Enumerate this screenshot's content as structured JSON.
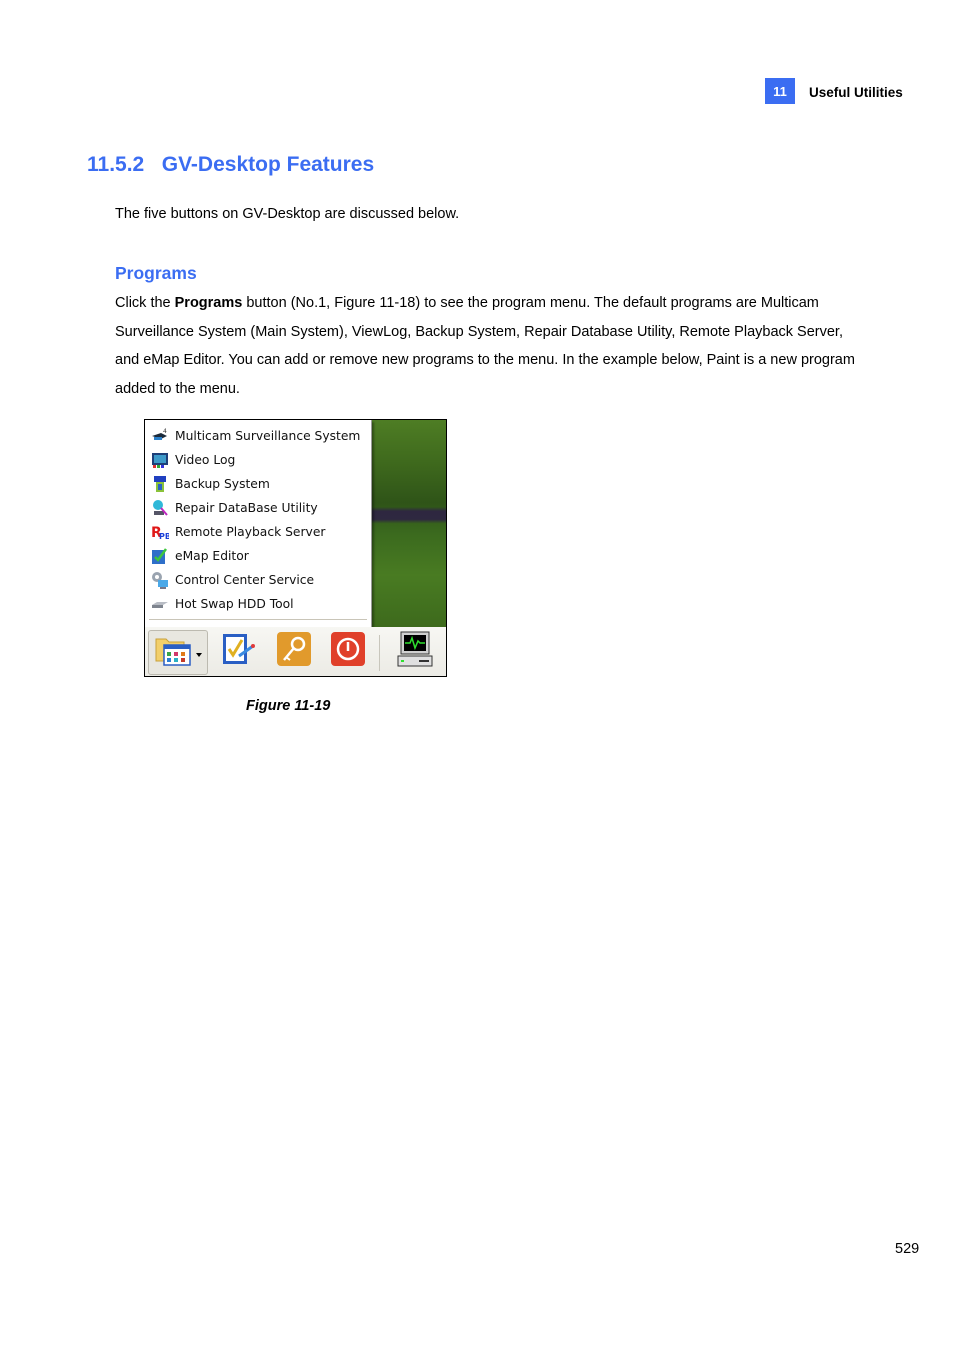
{
  "header": {
    "chapter_number": "11",
    "chapter_title": "Useful Utilities"
  },
  "section": {
    "number": "11.5.2",
    "title": "GV-Desktop Features",
    "intro": "The five buttons on GV-Desktop are discussed below."
  },
  "programs": {
    "heading": "Programs",
    "para_prefix": "Click the ",
    "para_bold": "Programs",
    "para_rest": " button (No.1, Figure 11-18) to see the program menu. The default programs are Multicam Surveillance System (Main System), ViewLog, Backup System, Repair Database Utility, Remote Playback Server, and eMap Editor. You can add or remove new programs to the menu. In the example below, Paint is a new program added to the menu."
  },
  "figure": {
    "menu_items": [
      {
        "label": "Multicam Surveillance System",
        "icon": "multicam-icon"
      },
      {
        "label": "Video Log",
        "icon": "video-log-icon"
      },
      {
        "label": "Backup System",
        "icon": "backup-icon"
      },
      {
        "label": "Repair DataBase Utility",
        "icon": "repair-database-icon"
      },
      {
        "label": "Remote Playback Server",
        "icon": "remote-playback-icon"
      },
      {
        "label": "eMap Editor",
        "icon": "emap-editor-icon"
      },
      {
        "label": "Control Center Service",
        "icon": "control-center-icon"
      },
      {
        "label": "Hot Swap HDD Tool",
        "icon": "hot-swap-hdd-icon"
      }
    ],
    "taskbar_buttons": [
      {
        "name": "programs",
        "icon": "programs-folder-icon"
      },
      {
        "name": "edit",
        "icon": "checklist-pen-icon"
      },
      {
        "name": "key",
        "icon": "key-icon"
      },
      {
        "name": "power",
        "icon": "power-icon"
      },
      {
        "name": "monitor",
        "icon": "system-monitor-icon"
      }
    ],
    "caption": "Figure 11-19"
  },
  "footer": {
    "page_number": "529"
  }
}
